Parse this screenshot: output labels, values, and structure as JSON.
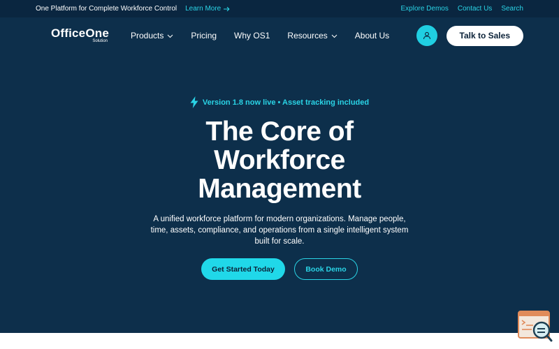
{
  "topbar": {
    "announcement": "One Platform for Complete Workforce Control",
    "learn_more": "Learn More",
    "links": [
      "Explore Demos",
      "Contact Us",
      "Search"
    ]
  },
  "nav": {
    "logo_word": "OfficeOne",
    "logo_sub": "Solution",
    "items": [
      {
        "label": "Products",
        "dropdown": true
      },
      {
        "label": "Pricing",
        "dropdown": false
      },
      {
        "label": "Why OS1",
        "dropdown": false
      },
      {
        "label": "Resources",
        "dropdown": true
      },
      {
        "label": "About Us",
        "dropdown": false
      }
    ],
    "talk_to_sales": "Talk to Sales"
  },
  "hero": {
    "badge": "Version 1.8 now live • Asset tracking included",
    "title_lines": [
      "The Core of",
      "Workforce",
      "Management"
    ],
    "subtitle": "A unified workforce platform for modern organizations. Manage people, time, assets, compliance, and operations from a single intelligent system built for scale.",
    "primary_cta": "Get Started Today",
    "secondary_cta": "Book Demo"
  },
  "colors": {
    "background": "#0d2f4b",
    "topbar": "#0a2640",
    "accent": "#20d8e9",
    "white": "#ffffff"
  },
  "icons": {
    "arrow": "arrow-right-icon",
    "chevron": "chevron-down-icon",
    "user": "user-icon",
    "bolt": "lightning-bolt-icon",
    "chat": "chat-support-icon"
  }
}
